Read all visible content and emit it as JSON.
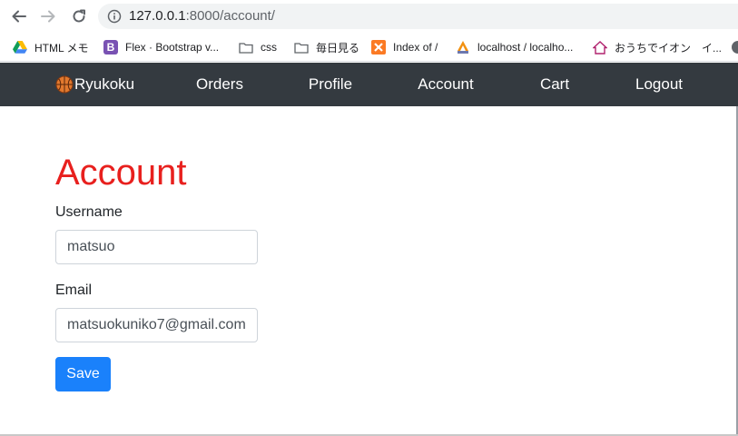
{
  "browser": {
    "url_host": "127.0.0.1",
    "url_rest": ":8000/account/",
    "bookmarks": [
      {
        "label": "HTML メモ",
        "icon": "google-drive-icon"
      },
      {
        "label": "Flex · Bootstrap v...",
        "icon": "bootstrap-icon",
        "icon_text": "B"
      },
      {
        "label": "css",
        "icon": "folder-icon"
      },
      {
        "label": "毎日見る",
        "icon": "folder-icon"
      },
      {
        "label": "Index of /",
        "icon": "xampp-icon"
      },
      {
        "label": "localhost / localho...",
        "icon": "phpmyadmin-icon"
      },
      {
        "label": "おうちでイオン　イ...",
        "icon": "house-icon"
      }
    ]
  },
  "navbar": {
    "brand_label": "Ryukoku",
    "links": [
      "Orders",
      "Profile",
      "Account",
      "Cart",
      "Logout"
    ]
  },
  "form": {
    "title": "Account",
    "username_label": "Username",
    "username_value": "matsuo",
    "email_label": "Email",
    "email_value": "matsuokuniko7@gmail.com",
    "save_label": "Save"
  },
  "colors": {
    "navbar_bg": "#343a40",
    "title": "#e8201e",
    "primary": "#1a81fb"
  }
}
